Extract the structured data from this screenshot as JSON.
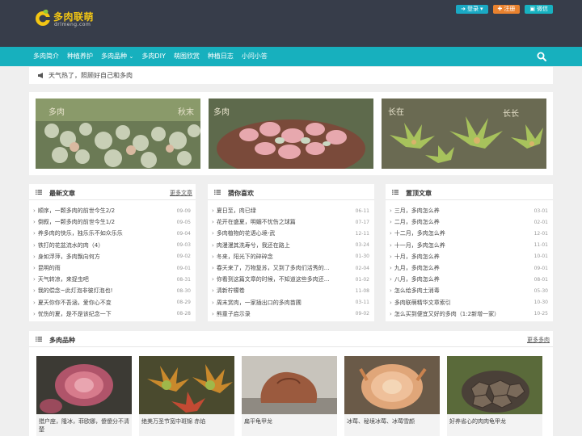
{
  "header": {
    "logo_text": "多肉联萌",
    "logo_sub": "drlmeng.com",
    "login_label": "登录",
    "register_label": "注册",
    "wechat_label": "微信",
    "colors": {
      "topbar": "#373d4a",
      "nav": "#17b0be",
      "accent_yellow": "#f3c613",
      "register": "#e9822f"
    }
  },
  "nav": {
    "items": [
      {
        "label": "多肉简介"
      },
      {
        "label": "种植养护"
      },
      {
        "label": "多肉品种"
      },
      {
        "label": "多肉DIY"
      },
      {
        "label": "萌图欣赏"
      },
      {
        "label": "种植日志"
      },
      {
        "label": "小问小答"
      }
    ],
    "dropdown_suffix": "⌄"
  },
  "notice": {
    "text": "天气热了，照顾好自己和多肉"
  },
  "banner": {
    "images": [
      {
        "icon": "succulent-cluster-photo",
        "watermark_left": "多肉",
        "watermark_right": "秋末"
      },
      {
        "icon": "pink-succulent-pot-photo",
        "watermark_left": "多肉"
      },
      {
        "icon": "green-succulent-rosettes-photo",
        "watermark_left": "长在",
        "watermark_right": "长长"
      }
    ]
  },
  "latest": {
    "title": "最新文章",
    "more": "更多文章",
    "items": [
      {
        "title": "顺序，一颗多肉的前世今生2/2",
        "date": "09-09"
      },
      {
        "title": "倒叙，一颗多肉的前世今生1/2",
        "date": "09-05"
      },
      {
        "title": "养多肉的快乐，独乐乐不如众乐乐",
        "date": "09-04"
      },
      {
        "title": "铁打的花盆流水的肉（4）",
        "date": "09-03"
      },
      {
        "title": "身如浮萍，多肉飘向何方",
        "date": "09-02"
      },
      {
        "title": "昆明的雨",
        "date": "09-01"
      },
      {
        "title": "天气转凉，来捉虫吧",
        "date": "08-31"
      },
      {
        "title": "我的偿念~此灯泡非彼灯泡也!",
        "date": "08-30"
      },
      {
        "title": "夏天你你不吾涵，爱你心不变",
        "date": "08-29"
      },
      {
        "title": "忧伤的夏，是不是该纪念一下",
        "date": "08-28"
      }
    ]
  },
  "guess": {
    "title": "猜你喜欢",
    "items": [
      {
        "title": "夏日至，肉已绿",
        "date": "06-11"
      },
      {
        "title": "花开在盛夏，明媚不忧伤之球篇",
        "date": "07-17"
      },
      {
        "title": "多肉植物的花语心境-武",
        "date": "12-11"
      },
      {
        "title": "肉漫漫其洗寿兮，我还在路上",
        "date": "03-24"
      },
      {
        "title": "冬来，阳光下的碎碎念",
        "date": "01-30"
      },
      {
        "title": "春天来了，万物复苏，又到了多肉们活秀的...",
        "date": "02-04"
      },
      {
        "title": "你看到这篇文章的时候，不知道这些多肉还...",
        "date": "01-02"
      },
      {
        "title": "清新柠檬卷",
        "date": "11-08"
      },
      {
        "title": "周末赏肉，一家插出口的多肉苗圃",
        "date": "03-11"
      },
      {
        "title": "熊童子启示录",
        "date": "09-02"
      }
    ]
  },
  "top": {
    "title": "置顶文章",
    "items": [
      {
        "title": "三月，多肉怎么养",
        "date": "03-01"
      },
      {
        "title": "二月，多肉怎么养",
        "date": "02-01"
      },
      {
        "title": "十二月，多肉怎么养",
        "date": "12-01"
      },
      {
        "title": "十一月，多肉怎么养",
        "date": "11-01"
      },
      {
        "title": "十月，多肉怎么养",
        "date": "10-01"
      },
      {
        "title": "九月，多肉怎么养",
        "date": "09-01"
      },
      {
        "title": "八月，多肉怎么养",
        "date": "08-01"
      },
      {
        "title": "怎么给多肉土消毒",
        "date": "05-30"
      },
      {
        "title": "多肉联萌精华文章索引",
        "date": "10-30"
      },
      {
        "title": "怎么买到便宜又好的多肉（1:2新增一家）",
        "date": "10-25"
      }
    ]
  },
  "varieties": {
    "title": "多肉品种",
    "more": "更多多肉",
    "cards": [
      {
        "caption": "猎户座，隆冰，菲欧娜，傻傻分不清楚",
        "icon": "pink-rosette-photo"
      },
      {
        "caption": "绝美万圣节宽中斑锦 赤焰",
        "icon": "red-green-rosettes-photo"
      },
      {
        "caption": "扁平龟甲龙",
        "icon": "caudex-plant-photo"
      },
      {
        "caption": "冰莓、秘境冰莓、冰莓雪颜",
        "icon": "peach-rosette-photo"
      },
      {
        "caption": "好养省心的肉肉龟甲龙",
        "icon": "tortoise-caudex-photo"
      }
    ]
  }
}
